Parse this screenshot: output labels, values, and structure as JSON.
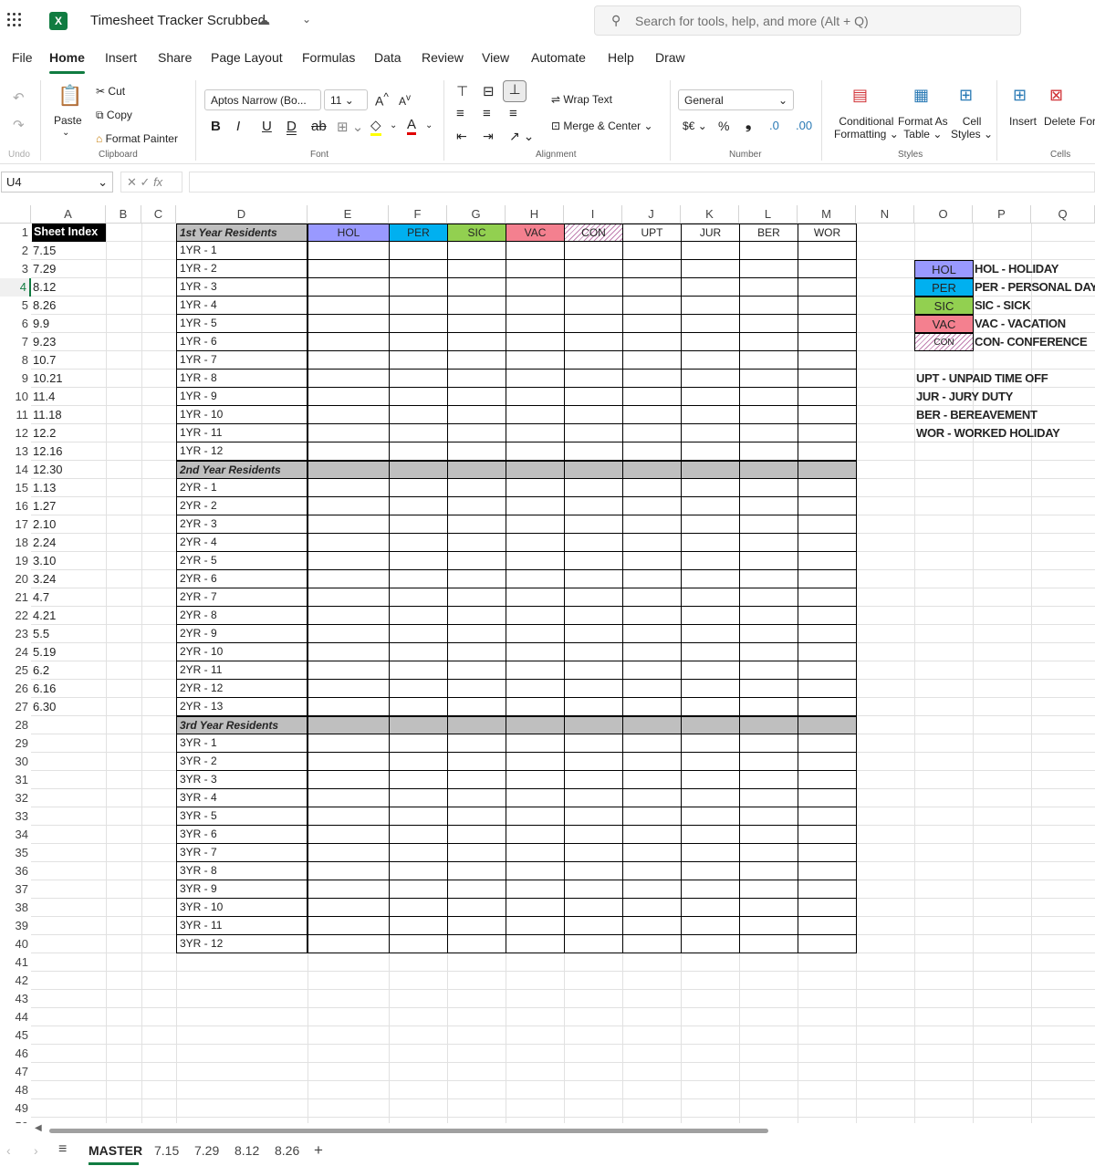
{
  "titlebar": {
    "title": "Timesheet Tracker Scrubbed",
    "search_placeholder": "Search for tools, help, and more (Alt + Q)"
  },
  "menu": [
    "File",
    "Home",
    "Insert",
    "Share",
    "Page Layout",
    "Formulas",
    "Data",
    "Review",
    "View",
    "Automate",
    "Help",
    "Draw"
  ],
  "ribbon": {
    "undo_group": "Undo",
    "paste": "Paste",
    "cut": "Cut",
    "copy": "Copy",
    "format_painter": "Format Painter",
    "clipboard_group": "Clipboard",
    "font_name": "Aptos Narrow (Bo...",
    "font_size": "11",
    "font_group": "Font",
    "wrap_text": "Wrap Text",
    "merge_center": "Merge & Center",
    "alignment_group": "Alignment",
    "number_format": "General",
    "currency": "$€",
    "percent": "%",
    "comma": "❟",
    "number_group": "Number",
    "cond_format_1": "Conditional",
    "cond_format_2": "Formatting",
    "format_table_1": "Format As",
    "format_table_2": "Table",
    "cell_styles_1": "Cell",
    "cell_styles_2": "Styles",
    "styles_group": "Styles",
    "insert": "Insert",
    "delete": "Delete",
    "format": "For",
    "cells_group": "Cells"
  },
  "formula_bar": {
    "name_box": "U4",
    "fx": "fx",
    "value": ""
  },
  "columns": [
    "A",
    "B",
    "C",
    "D",
    "E",
    "F",
    "G",
    "H",
    "I",
    "J",
    "K",
    "L",
    "M",
    "N",
    "O",
    "P",
    "Q"
  ],
  "sheet_index": {
    "header": "Sheet Index",
    "items": [
      "7.15",
      "7.29",
      "8.12",
      "8.26",
      "9.9",
      "9.23",
      "10.7",
      "10.21",
      "11.4",
      "11.18",
      "12.2",
      "12.16",
      "12.30",
      "1.13",
      "1.27",
      "2.10",
      "2.24",
      "3.10",
      "3.24",
      "4.7",
      "4.21",
      "5.5",
      "5.19",
      "6.2",
      "6.16",
      "6.30"
    ]
  },
  "table": {
    "headers": [
      "HOL",
      "PER",
      "SIC",
      "VAC",
      "CON",
      "UPT",
      "JUR",
      "BER",
      "WOR"
    ],
    "header_colors": [
      "#9999ff",
      "#00b0f0",
      "#92d050",
      "#f4808f",
      "striped",
      "#ffffff",
      "#ffffff",
      "#ffffff",
      "#ffffff"
    ],
    "sections": [
      {
        "title": "1st Year Residents",
        "rows": [
          "1YR - 1",
          "1YR - 2",
          "1YR - 3",
          "1YR - 4",
          "1YR - 5",
          "1YR - 6",
          "1YR - 7",
          "1YR - 8",
          "1YR - 9",
          "1YR - 10",
          "1YR - 11",
          "1YR - 12"
        ]
      },
      {
        "title": "2nd Year Residents",
        "rows": [
          "2YR - 1",
          "2YR - 2",
          "2YR - 3",
          "2YR - 4",
          "2YR - 5",
          "2YR - 6",
          "2YR - 7",
          "2YR - 8",
          "2YR - 9",
          "2YR - 10",
          "2YR - 11",
          "2YR - 12",
          "2YR - 13"
        ]
      },
      {
        "title": "3rd Year Residents",
        "rows": [
          "3YR - 1",
          "3YR - 2",
          "3YR - 3",
          "3YR - 4",
          "3YR - 5",
          "3YR - 6",
          "3YR - 7",
          "3YR - 8",
          "3YR - 9",
          "3YR - 10",
          "3YR - 11",
          "3YR - 12"
        ]
      }
    ]
  },
  "legend": {
    "colored": [
      {
        "code": "HOL",
        "label": "HOL - HOLIDAY",
        "color": "#9999ff"
      },
      {
        "code": "PER",
        "label": "PER - PERSONAL DAY",
        "color": "#00b0f0"
      },
      {
        "code": "SIC",
        "label": "SIC - SICK",
        "color": "#92d050"
      },
      {
        "code": "VAC",
        "label": "VAC - VACATION",
        "color": "#f4808f"
      },
      {
        "code": "CON",
        "label": "CON- CONFERENCE",
        "color": "striped"
      }
    ],
    "plain": [
      "UPT - UNPAID TIME OFF",
      "JUR - JURY DUTY",
      "BER - BEREAVEMENT",
      "WOR - WORKED HOLIDAY"
    ]
  },
  "row_count": 50,
  "sheet_tabs": {
    "menu_icon": "hamburger-icon",
    "tabs": [
      "MASTER",
      "7.15",
      "7.29",
      "8.12",
      "8.26"
    ],
    "active": "MASTER",
    "add": "+"
  }
}
